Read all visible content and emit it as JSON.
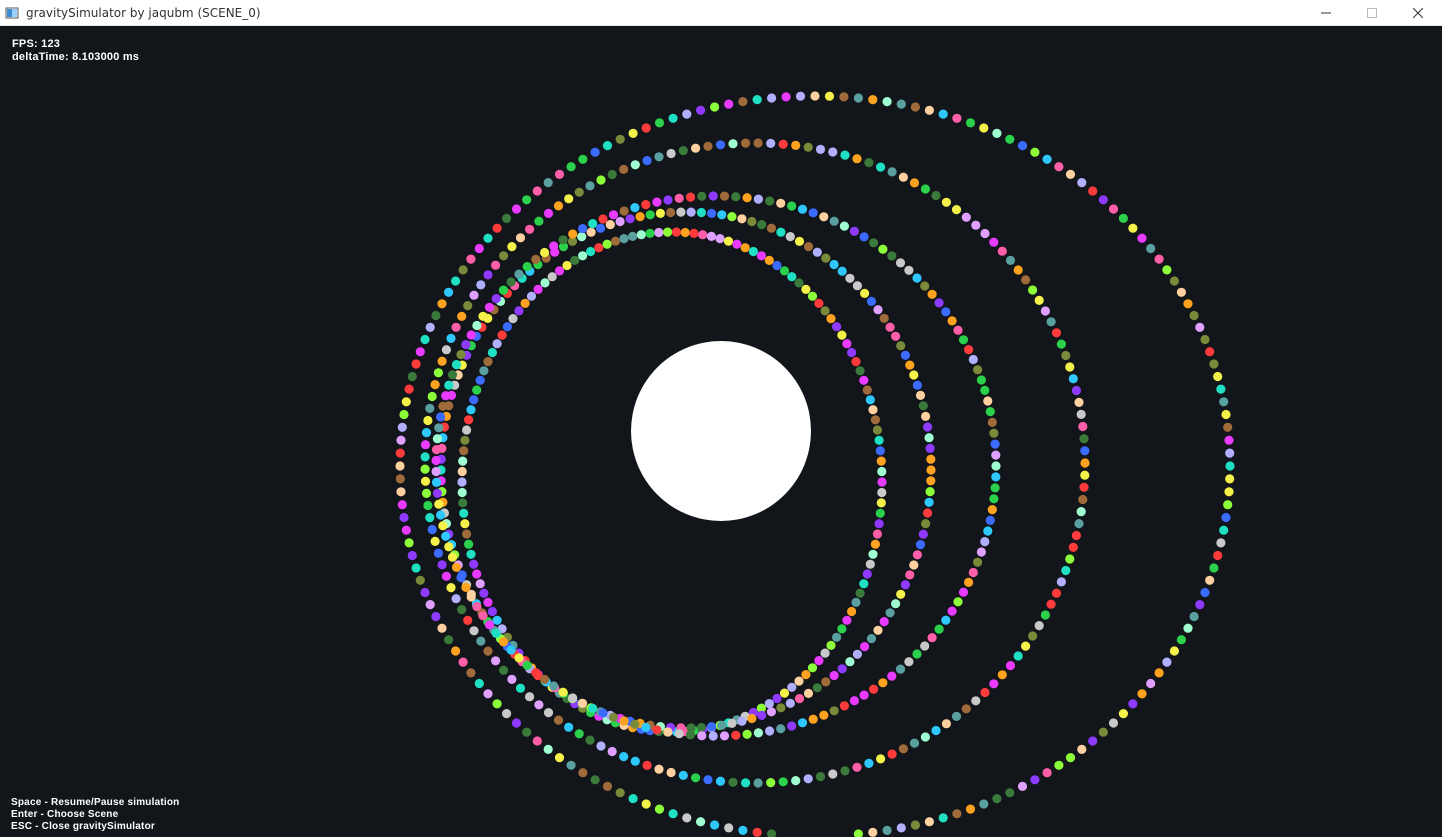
{
  "window": {
    "title": "gravitySimulator by jaqubm (SCENE_0)",
    "controls": [
      "minimize-icon",
      "maximize-icon",
      "close-icon"
    ]
  },
  "hud": {
    "fps_label": "FPS:",
    "fps_value": "123",
    "delta_label": "deltaTime:",
    "delta_value": "8.103000 ms"
  },
  "help": {
    "space": "Space - Resume/Pause simulation",
    "enter": "Enter - Choose Scene",
    "esc": "ESC - Close gravitySimulator"
  },
  "scene": {
    "background_color": "#121519",
    "central_body_color": "#ffffff",
    "particle_palette": [
      "#ff3b3b",
      "#ffa21f",
      "#f4f14a",
      "#8cff3a",
      "#2bd14b",
      "#1fe0c3",
      "#2ec8ff",
      "#3b6bff",
      "#8e3bff",
      "#e83bff",
      "#ff5fa8",
      "#c9c9c9",
      "#7a8a3a",
      "#5aa0a0",
      "#a06b3a",
      "#3a7a3a",
      "#e0a0ff",
      "#a0ffd0",
      "#ffd0a0",
      "#b0b0ff"
    ]
  }
}
